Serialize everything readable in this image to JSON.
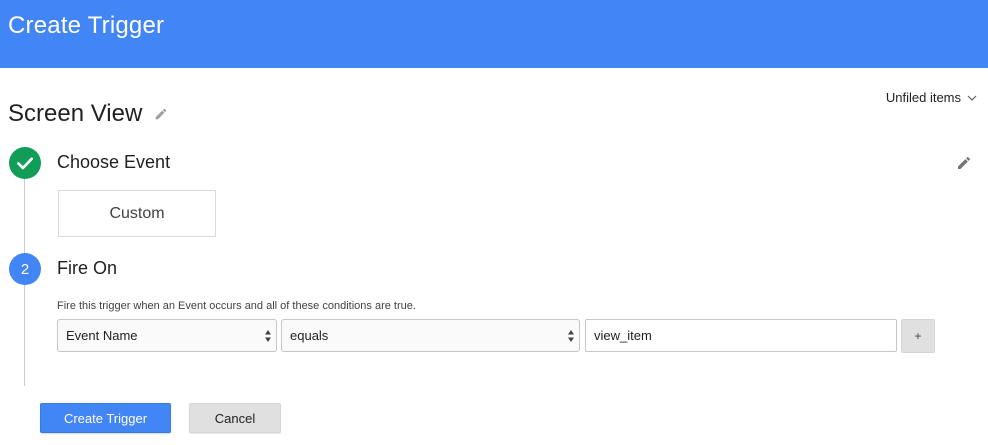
{
  "header": {
    "title": "Create Trigger"
  },
  "folder": {
    "label": "Unfiled items"
  },
  "trigger": {
    "name": "Screen View"
  },
  "steps": [
    {
      "state": "complete",
      "title": "Choose Event",
      "event_type": "Custom"
    },
    {
      "number": "2",
      "title": "Fire On",
      "description": "Fire this trigger when an Event occurs and all of these conditions are true."
    }
  ],
  "condition": {
    "field": "Event Name",
    "operator": "equals",
    "value": "view_item",
    "add_label": "+"
  },
  "actions": {
    "create_label": "Create Trigger",
    "cancel_label": "Cancel"
  },
  "colors": {
    "header": "#4285f4",
    "step_complete": "#0f9d58",
    "step_active": "#4285f4",
    "primary_button": "#4285f4"
  },
  "icons": {
    "name_edit": "pencil-icon",
    "step_edit": "pencil-icon",
    "step_complete": "checkmark-icon",
    "folder_dropdown": "chevron-down-icon",
    "select_arrows": "updown-arrows-icon"
  }
}
